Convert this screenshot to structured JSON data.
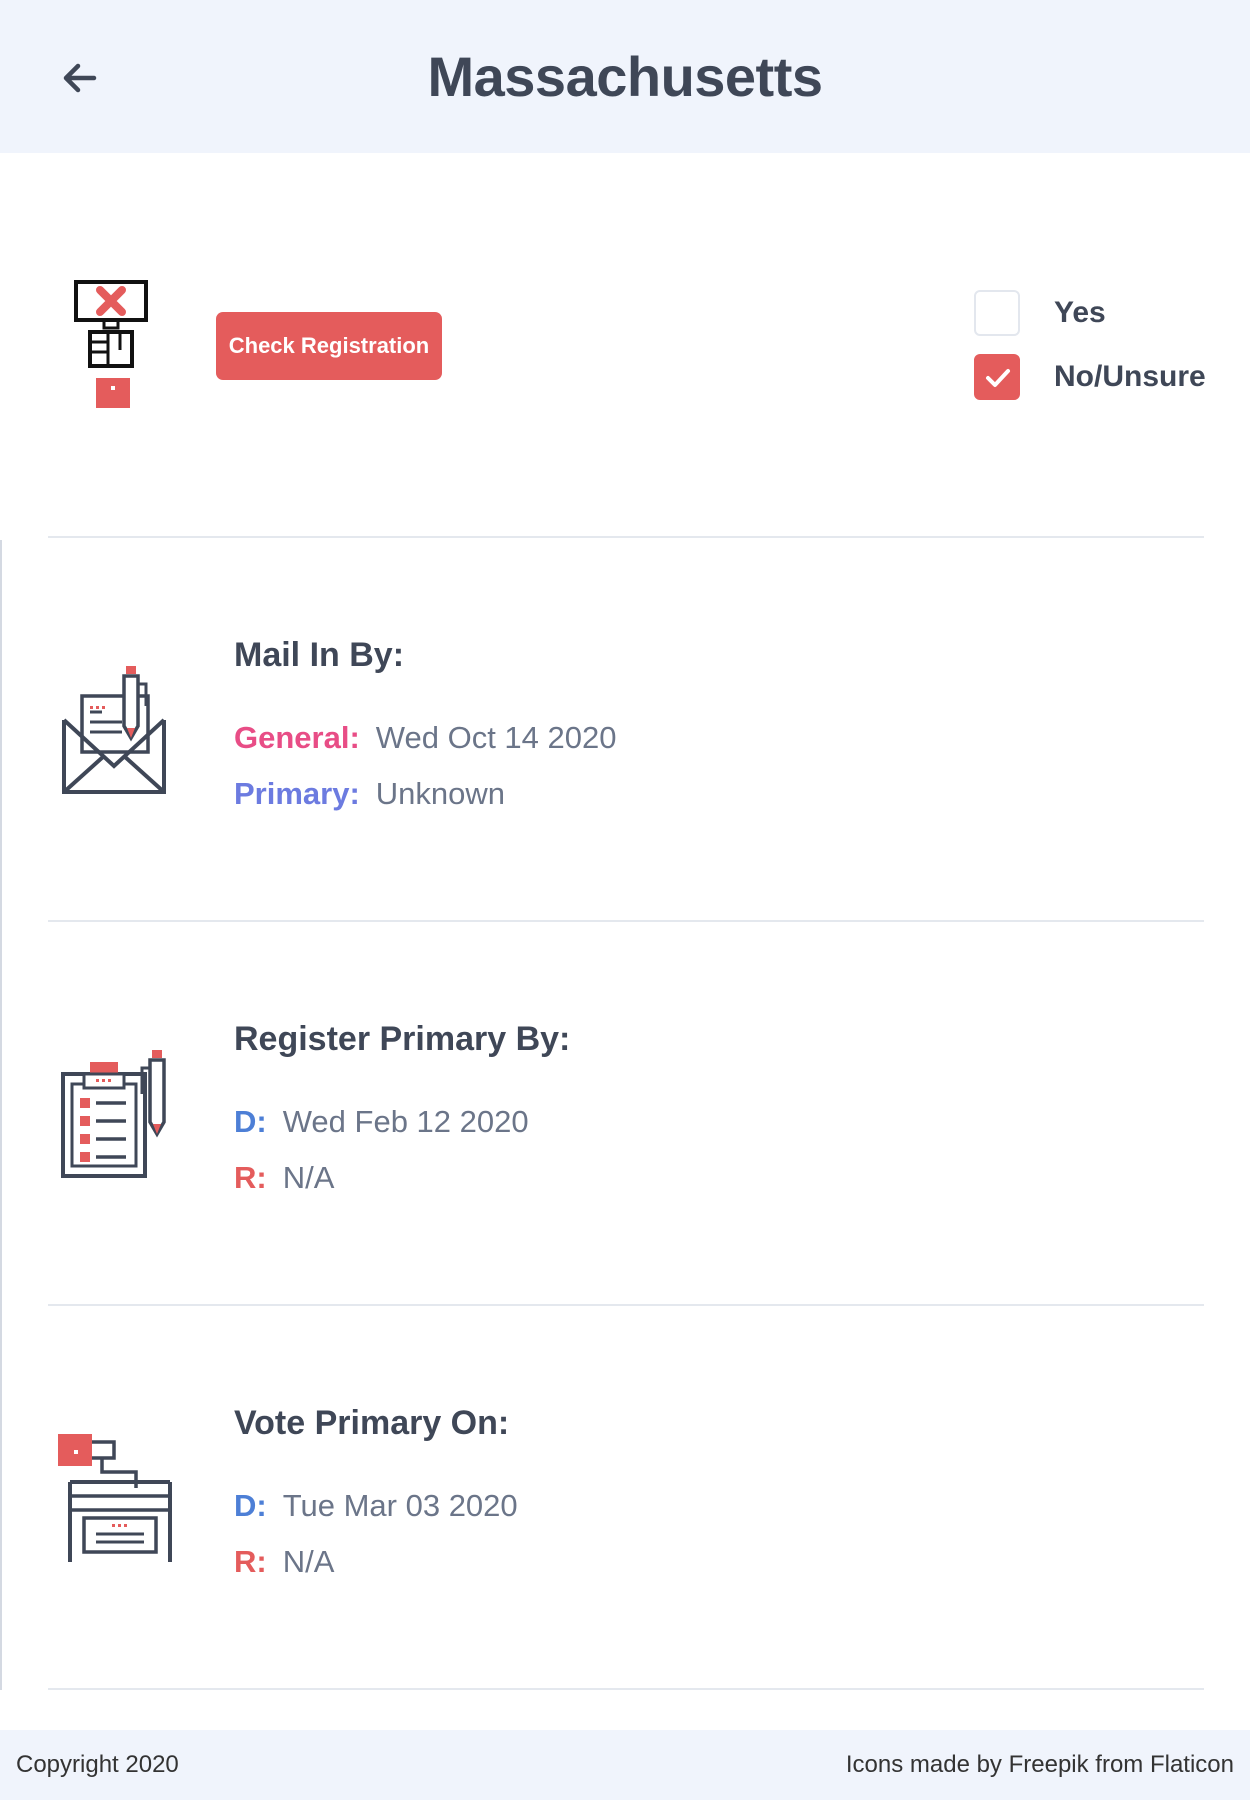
{
  "header": {
    "title": "Massachusetts"
  },
  "registration": {
    "check_button_label": "Check Registration",
    "options": [
      {
        "label": "Yes",
        "checked": false
      },
      {
        "label": "No/Unsure",
        "checked": true
      }
    ]
  },
  "sections": [
    {
      "title": "Mail In By:",
      "icon": "envelope-pen-icon",
      "rows": [
        {
          "key": "General:",
          "value": "Wed Oct 14 2020",
          "key_color": "#e84d86"
        },
        {
          "key": "Primary:",
          "value": "Unknown",
          "key_color": "#6c7be0"
        }
      ]
    },
    {
      "title": "Register Primary By:",
      "icon": "clipboard-pen-icon",
      "rows": [
        {
          "key": "D:",
          "value": "Wed Feb 12 2020",
          "key_color": "#4d7fd6"
        },
        {
          "key": "R:",
          "value": "N/A",
          "key_color": "#e45c5c"
        }
      ]
    },
    {
      "title": "Vote Primary On:",
      "icon": "ballot-box-icon",
      "rows": [
        {
          "key": "D:",
          "value": "Tue Mar 03 2020",
          "key_color": "#4d7fd6"
        },
        {
          "key": "R:",
          "value": "N/A",
          "key_color": "#e45c5c"
        }
      ]
    }
  ],
  "footer": {
    "copyright": "Copyright 2020",
    "credits": "Icons made by Freepik from Flaticon"
  },
  "colors": {
    "accent": "#e45c5c",
    "header_bg": "#f0f4fc",
    "text": "#3f4757"
  }
}
